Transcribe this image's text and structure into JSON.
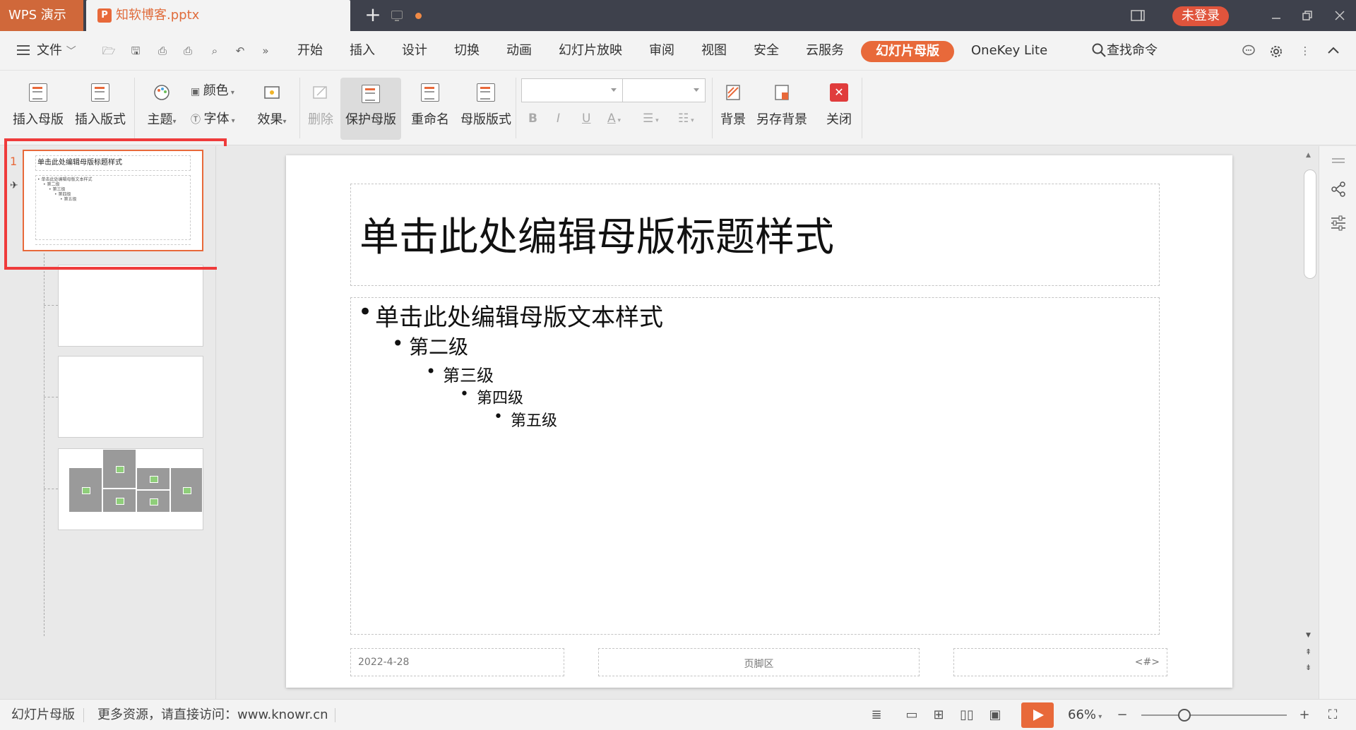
{
  "titlebar": {
    "app_name": "WPS 演示",
    "doc_name": "知软博客.pptx",
    "login": "未登录",
    "ppt_glyph": "P"
  },
  "menubar": {
    "file": "文件",
    "tabs": [
      "开始",
      "插入",
      "设计",
      "切换",
      "动画",
      "幻灯片放映",
      "审阅",
      "视图",
      "安全",
      "云服务",
      "幻灯片母版",
      "OneKey Lite"
    ],
    "active_tab": "幻灯片母版",
    "search": "查找命令"
  },
  "ribbon": {
    "insert_master": "插入母版",
    "insert_layout": "插入版式",
    "theme": "主题",
    "colors": "颜色",
    "fonts": "字体",
    "effects": "效果",
    "delete": "删除",
    "protect_master": "保护母版",
    "rename": "重命名",
    "master_layout": "母版版式",
    "format_bold": "B",
    "format_italic": "I",
    "format_underline": "U",
    "format_font_color": "A",
    "background": "背景",
    "save_background": "另存背景",
    "close": "关闭"
  },
  "thumbnails": {
    "master_index": "1",
    "master_title": "单击此处编辑母版标题样式",
    "master_body": [
      "• 单击此处编辑母版文本样式",
      "• 第二级",
      "• 第三级",
      "• 第四级",
      "• 第五级"
    ]
  },
  "slide": {
    "title": "单击此处编辑母版标题样式",
    "levels": [
      "单击此处编辑母版文本样式",
      "第二级",
      "第三级",
      "第四级",
      "第五级"
    ],
    "footer_date": "2022-4-28",
    "footer_center": "页脚区",
    "footer_number": "<#>"
  },
  "statusbar": {
    "mode": "幻灯片母版",
    "promo": "更多资源，请直接访问：www.knowr.cn",
    "zoom": "66%",
    "zoom_level": 0.66
  },
  "colors": {
    "accent": "#e8693a",
    "login_red": "#e0543c",
    "highlight_frame": "#ef3b3b"
  }
}
